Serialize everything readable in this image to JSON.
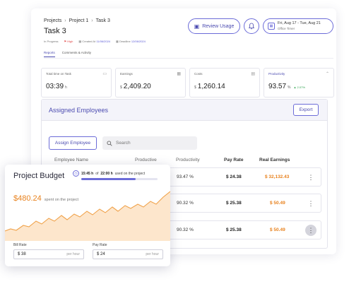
{
  "breadcrumb": [
    "Projects",
    "Project 1",
    "Task 3"
  ],
  "task": {
    "title": "Task 3",
    "status": "In Progress",
    "priority": "High",
    "created_label": "Created At",
    "created_date": "11/06/2024",
    "deadline_label": "Deadline",
    "deadline_date": "12/06/2024"
  },
  "header": {
    "review_label": "Review Usage",
    "range_line1": "Fri, Aug 17 - Tue, Aug 21",
    "range_line2": "Office Timer"
  },
  "tabs": [
    {
      "label": "Reports",
      "active": true
    },
    {
      "label": "Comments & Activity",
      "active": false
    }
  ],
  "stats": [
    {
      "label": "Total time on Task",
      "value": "03:39",
      "unit": "h",
      "icon": "briefcase-icon"
    },
    {
      "label": "Earnings",
      "currency": "$",
      "value": "2,409.20",
      "icon": "calendar-icon"
    },
    {
      "label": "Costs",
      "currency": "$",
      "value": "1,260.14",
      "icon": "card-icon"
    },
    {
      "label": "Productivity",
      "value": "93.57",
      "unit": "%",
      "delta": "▲ 2.07%",
      "icon": "chevron-up-icon"
    }
  ],
  "employees": {
    "title": "Assigned Employees",
    "export_label": "Export",
    "assign_label": "Assign Employee",
    "search_placeholder": "Search",
    "columns": [
      "Employee Name",
      "Productive",
      "Productivity",
      "Pay Rate",
      "Real Earnings"
    ],
    "rows": [
      {
        "productivity": "93.47 %",
        "pay_rate": "$ 24.38",
        "earnings": "$ 32,132.43"
      },
      {
        "productivity": "90.32 %",
        "pay_rate": "$ 25.38",
        "earnings": "$ 50.49"
      },
      {
        "productivity": "90.32 %",
        "pay_rate": "$ 25.38",
        "earnings": "$ 50.49"
      }
    ]
  },
  "budget": {
    "title": "Project Budget",
    "time_used": "15:45 h",
    "time_of": "of",
    "time_total": "22:00 h",
    "time_suffix": "used on the project",
    "time_fraction": 0.716,
    "amount": "$480.24",
    "amount_label": "spent on the project",
    "bill_rate_label": "Bill Rate",
    "bill_rate_value": "$ 38",
    "pay_rate_label": "Pay Rate",
    "pay_rate_value": "$ 24",
    "per_hour": "per hour",
    "accent": "#e8821e"
  }
}
